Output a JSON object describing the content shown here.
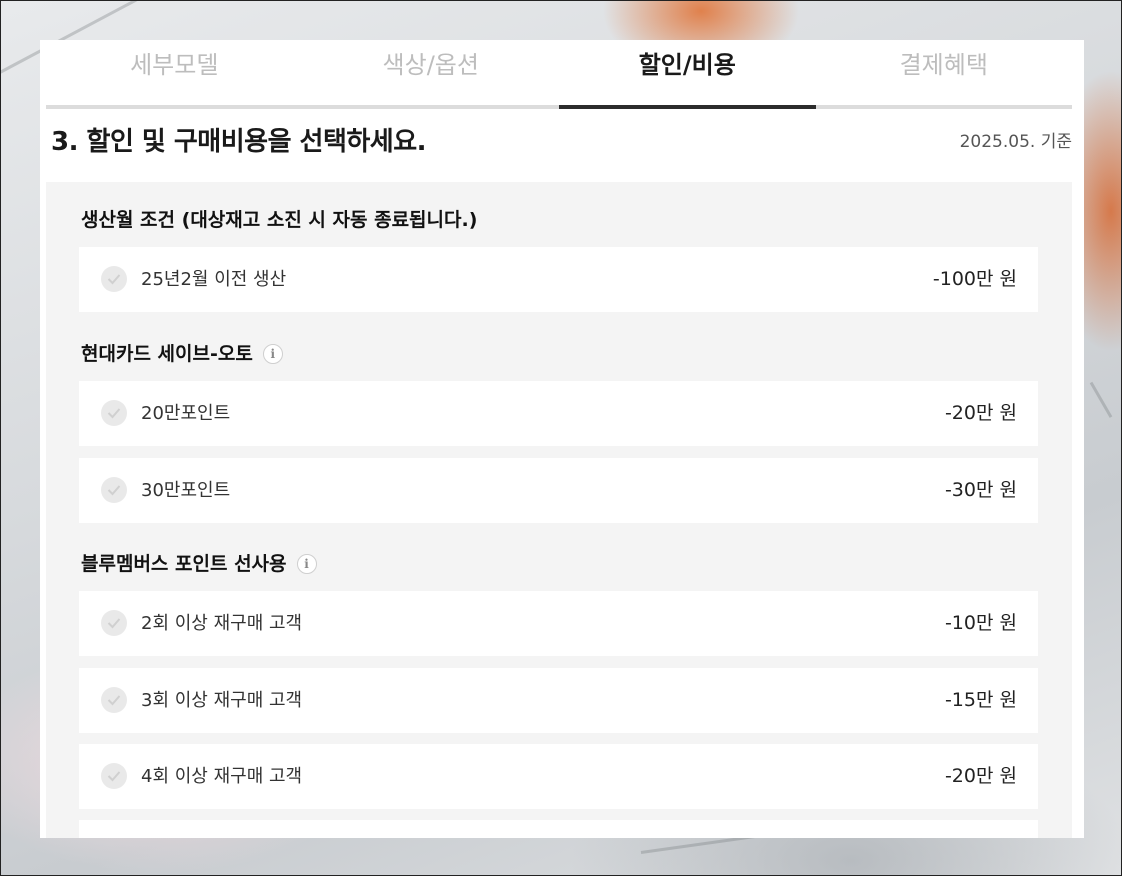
{
  "tabs": [
    {
      "label": "세부모델",
      "active": false
    },
    {
      "label": "색상/옵션",
      "active": false
    },
    {
      "label": "할인/비용",
      "active": true
    },
    {
      "label": "결제혜택",
      "active": false
    }
  ],
  "heading": "3. 할인 및 구매비용을 선택하세요.",
  "date_note": "2025.05. 기준",
  "groups": [
    {
      "title": "생산월 조건 (대상재고 소진 시 자동 종료됩니다.)",
      "has_info": false,
      "options": [
        {
          "label": "25년2월 이전 생산",
          "amount": "-100만 원",
          "checked": false
        }
      ]
    },
    {
      "title": "현대카드 세이브-오토",
      "has_info": true,
      "options": [
        {
          "label": "20만포인트",
          "amount": "-20만 원",
          "checked": false
        },
        {
          "label": "30만포인트",
          "amount": "-30만 원",
          "checked": false
        }
      ]
    },
    {
      "title": "블루멤버스 포인트 선사용",
      "has_info": true,
      "options": [
        {
          "label": "2회 이상 재구매 고객",
          "amount": "-10만 원",
          "checked": false
        },
        {
          "label": "3회 이상 재구매 고객",
          "amount": "-15만 원",
          "checked": false
        },
        {
          "label": "4회 이상 재구매 고객",
          "amount": "-20만 원",
          "checked": false
        }
      ]
    }
  ],
  "icons": {
    "info": "info-icon",
    "check": "check-icon"
  },
  "colors": {
    "active_tab": "#1a1a1a",
    "inactive_tab": "#bdbdbd",
    "check_circle": "#e9e9e9",
    "section_bg": "#f4f4f4"
  }
}
